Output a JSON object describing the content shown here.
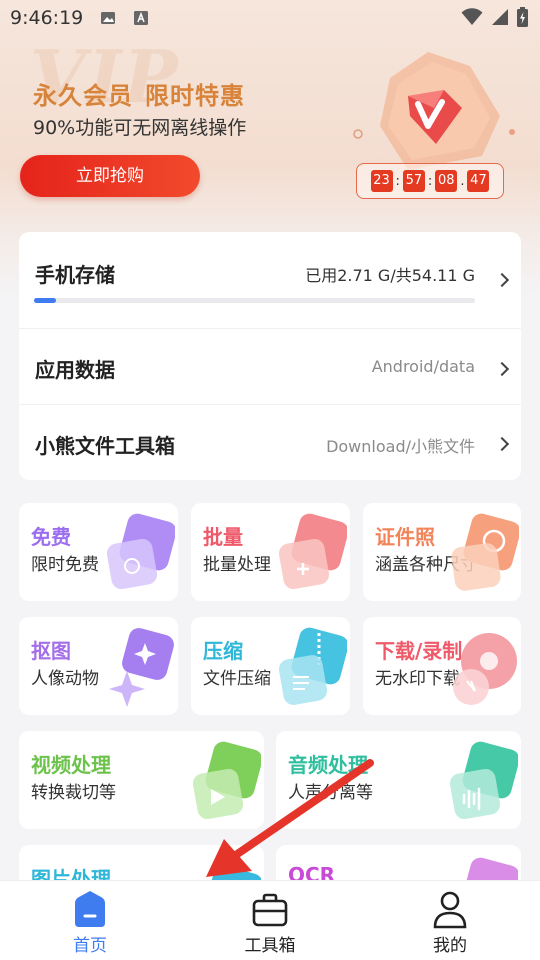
{
  "status_bar": {
    "time": "9:46:19"
  },
  "banner": {
    "watermark": "VIP",
    "title_a": "永久会员",
    "title_b": "限时特惠",
    "subtitle": "90%功能可无网离线操作",
    "buy_button": "立即抢购",
    "countdown": [
      "23",
      "57",
      "08",
      "47"
    ],
    "accent": "#d8833a",
    "button_color": "#e5231b"
  },
  "storage": {
    "phone_title": "手机存储",
    "phone_value": "已用2.71 G/共54.11 G",
    "used_fraction": 0.05,
    "app_data_title": "应用数据",
    "app_data_path": "Android/data",
    "toolbox_title": "小熊文件工具箱",
    "toolbox_path": "Download/小熊文件"
  },
  "tiles": [
    {
      "title": "免费",
      "subtitle": "限时免费",
      "color": "#9b6ef0",
      "icon": "gift-card-icon"
    },
    {
      "title": "批量",
      "subtitle": "批量处理",
      "color": "#ef5a6b",
      "icon": "batch-plus-icon"
    },
    {
      "title": "证件照",
      "subtitle": "涵盖各种尺寸",
      "color": "#f2845a",
      "icon": "id-photo-camera-icon"
    },
    {
      "title": "抠图",
      "subtitle": "人像动物",
      "color": "#a46ee8",
      "icon": "sparkle-cutout-icon"
    },
    {
      "title": "压缩",
      "subtitle": "文件压缩",
      "color": "#2fb7d9",
      "icon": "zip-compress-icon"
    },
    {
      "title": "下载/录制",
      "subtitle": "无水印下载",
      "color": "#ef5a6b",
      "icon": "download-disc-icon"
    },
    {
      "title": "视频处理",
      "subtitle": "转换裁切等",
      "color": "#6cc24a",
      "icon": "video-play-icon"
    },
    {
      "title": "音频处理",
      "subtitle": "人声分离等",
      "color": "#2fbf9e",
      "icon": "audio-wave-icon"
    },
    {
      "title": "图片处理",
      "subtitle": "",
      "color": "#2fb7d9",
      "icon": "image-edit-icon"
    },
    {
      "title": "OCR",
      "subtitle": "",
      "color": "#c94ad6",
      "icon": "ocr-scan-icon"
    }
  ],
  "nav": {
    "home": "首页",
    "toolbox": "工具箱",
    "mine": "我的",
    "active_color": "#3f7cf0"
  }
}
